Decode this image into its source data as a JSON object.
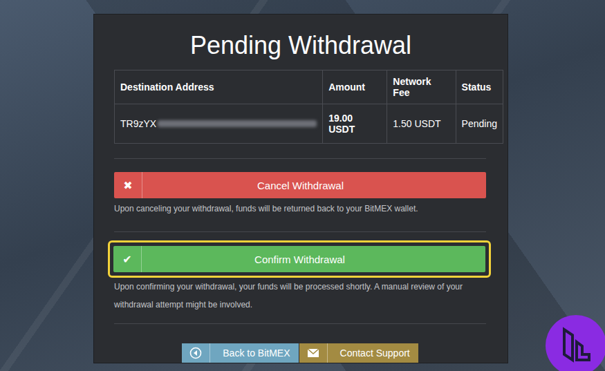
{
  "title": "Pending Withdrawal",
  "table": {
    "columns": [
      "Destination Address",
      "Amount",
      "Network Fee",
      "Status"
    ],
    "rows": [
      [
        "TR9zYX",
        "19.00 USDT",
        "1.50 USDT",
        "Pending"
      ]
    ]
  },
  "actions": [
    {
      "icon": "✖",
      "label": "Cancel Withdrawal",
      "note": "Upon canceling your withdrawal, funds will be returned back to your BitMEX wallet.",
      "color": "#d9534f",
      "highlighted": false
    },
    {
      "icon": "✔",
      "label": "Confirm Withdrawal",
      "note": "Upon confirming your withdrawal, your funds will be processed shortly. A manual review of your withdrawal attempt might be involved.",
      "color": "#5cb85c",
      "highlighted": true
    }
  ],
  "links": [
    {
      "label": "Back to BitMEX",
      "color": "#6fa6c0",
      "kind": "back"
    },
    {
      "label": "Contact Support",
      "color": "#a38b42",
      "kind": "mail"
    }
  ]
}
